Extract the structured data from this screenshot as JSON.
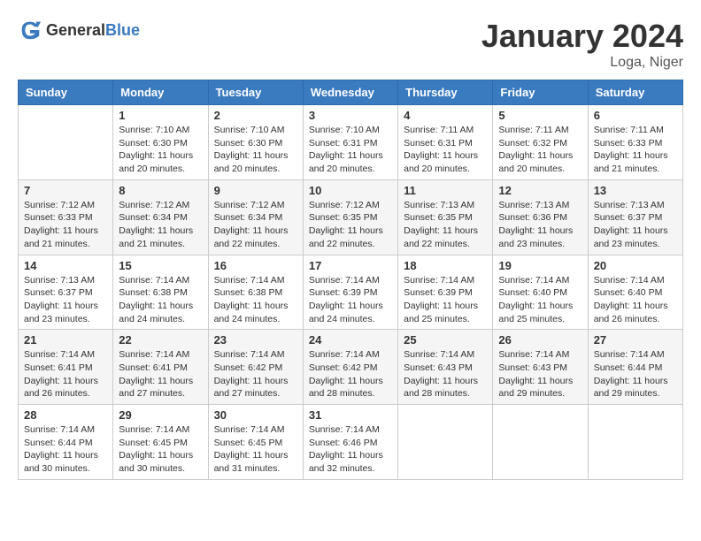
{
  "header": {
    "logo_general": "General",
    "logo_blue": "Blue",
    "month_title": "January 2024",
    "location": "Loga, Niger"
  },
  "weekdays": [
    "Sunday",
    "Monday",
    "Tuesday",
    "Wednesday",
    "Thursday",
    "Friday",
    "Saturday"
  ],
  "weeks": [
    [
      {
        "day": "",
        "sunrise": "",
        "sunset": "",
        "daylight": ""
      },
      {
        "day": "1",
        "sunrise": "Sunrise: 7:10 AM",
        "sunset": "Sunset: 6:30 PM",
        "daylight": "Daylight: 11 hours and 20 minutes."
      },
      {
        "day": "2",
        "sunrise": "Sunrise: 7:10 AM",
        "sunset": "Sunset: 6:30 PM",
        "daylight": "Daylight: 11 hours and 20 minutes."
      },
      {
        "day": "3",
        "sunrise": "Sunrise: 7:10 AM",
        "sunset": "Sunset: 6:31 PM",
        "daylight": "Daylight: 11 hours and 20 minutes."
      },
      {
        "day": "4",
        "sunrise": "Sunrise: 7:11 AM",
        "sunset": "Sunset: 6:31 PM",
        "daylight": "Daylight: 11 hours and 20 minutes."
      },
      {
        "day": "5",
        "sunrise": "Sunrise: 7:11 AM",
        "sunset": "Sunset: 6:32 PM",
        "daylight": "Daylight: 11 hours and 20 minutes."
      },
      {
        "day": "6",
        "sunrise": "Sunrise: 7:11 AM",
        "sunset": "Sunset: 6:33 PM",
        "daylight": "Daylight: 11 hours and 21 minutes."
      }
    ],
    [
      {
        "day": "7",
        "sunrise": "Sunrise: 7:12 AM",
        "sunset": "Sunset: 6:33 PM",
        "daylight": "Daylight: 11 hours and 21 minutes."
      },
      {
        "day": "8",
        "sunrise": "Sunrise: 7:12 AM",
        "sunset": "Sunset: 6:34 PM",
        "daylight": "Daylight: 11 hours and 21 minutes."
      },
      {
        "day": "9",
        "sunrise": "Sunrise: 7:12 AM",
        "sunset": "Sunset: 6:34 PM",
        "daylight": "Daylight: 11 hours and 22 minutes."
      },
      {
        "day": "10",
        "sunrise": "Sunrise: 7:12 AM",
        "sunset": "Sunset: 6:35 PM",
        "daylight": "Daylight: 11 hours and 22 minutes."
      },
      {
        "day": "11",
        "sunrise": "Sunrise: 7:13 AM",
        "sunset": "Sunset: 6:35 PM",
        "daylight": "Daylight: 11 hours and 22 minutes."
      },
      {
        "day": "12",
        "sunrise": "Sunrise: 7:13 AM",
        "sunset": "Sunset: 6:36 PM",
        "daylight": "Daylight: 11 hours and 23 minutes."
      },
      {
        "day": "13",
        "sunrise": "Sunrise: 7:13 AM",
        "sunset": "Sunset: 6:37 PM",
        "daylight": "Daylight: 11 hours and 23 minutes."
      }
    ],
    [
      {
        "day": "14",
        "sunrise": "Sunrise: 7:13 AM",
        "sunset": "Sunset: 6:37 PM",
        "daylight": "Daylight: 11 hours and 23 minutes."
      },
      {
        "day": "15",
        "sunrise": "Sunrise: 7:14 AM",
        "sunset": "Sunset: 6:38 PM",
        "daylight": "Daylight: 11 hours and 24 minutes."
      },
      {
        "day": "16",
        "sunrise": "Sunrise: 7:14 AM",
        "sunset": "Sunset: 6:38 PM",
        "daylight": "Daylight: 11 hours and 24 minutes."
      },
      {
        "day": "17",
        "sunrise": "Sunrise: 7:14 AM",
        "sunset": "Sunset: 6:39 PM",
        "daylight": "Daylight: 11 hours and 24 minutes."
      },
      {
        "day": "18",
        "sunrise": "Sunrise: 7:14 AM",
        "sunset": "Sunset: 6:39 PM",
        "daylight": "Daylight: 11 hours and 25 minutes."
      },
      {
        "day": "19",
        "sunrise": "Sunrise: 7:14 AM",
        "sunset": "Sunset: 6:40 PM",
        "daylight": "Daylight: 11 hours and 25 minutes."
      },
      {
        "day": "20",
        "sunrise": "Sunrise: 7:14 AM",
        "sunset": "Sunset: 6:40 PM",
        "daylight": "Daylight: 11 hours and 26 minutes."
      }
    ],
    [
      {
        "day": "21",
        "sunrise": "Sunrise: 7:14 AM",
        "sunset": "Sunset: 6:41 PM",
        "daylight": "Daylight: 11 hours and 26 minutes."
      },
      {
        "day": "22",
        "sunrise": "Sunrise: 7:14 AM",
        "sunset": "Sunset: 6:41 PM",
        "daylight": "Daylight: 11 hours and 27 minutes."
      },
      {
        "day": "23",
        "sunrise": "Sunrise: 7:14 AM",
        "sunset": "Sunset: 6:42 PM",
        "daylight": "Daylight: 11 hours and 27 minutes."
      },
      {
        "day": "24",
        "sunrise": "Sunrise: 7:14 AM",
        "sunset": "Sunset: 6:42 PM",
        "daylight": "Daylight: 11 hours and 28 minutes."
      },
      {
        "day": "25",
        "sunrise": "Sunrise: 7:14 AM",
        "sunset": "Sunset: 6:43 PM",
        "daylight": "Daylight: 11 hours and 28 minutes."
      },
      {
        "day": "26",
        "sunrise": "Sunrise: 7:14 AM",
        "sunset": "Sunset: 6:43 PM",
        "daylight": "Daylight: 11 hours and 29 minutes."
      },
      {
        "day": "27",
        "sunrise": "Sunrise: 7:14 AM",
        "sunset": "Sunset: 6:44 PM",
        "daylight": "Daylight: 11 hours and 29 minutes."
      }
    ],
    [
      {
        "day": "28",
        "sunrise": "Sunrise: 7:14 AM",
        "sunset": "Sunset: 6:44 PM",
        "daylight": "Daylight: 11 hours and 30 minutes."
      },
      {
        "day": "29",
        "sunrise": "Sunrise: 7:14 AM",
        "sunset": "Sunset: 6:45 PM",
        "daylight": "Daylight: 11 hours and 30 minutes."
      },
      {
        "day": "30",
        "sunrise": "Sunrise: 7:14 AM",
        "sunset": "Sunset: 6:45 PM",
        "daylight": "Daylight: 11 hours and 31 minutes."
      },
      {
        "day": "31",
        "sunrise": "Sunrise: 7:14 AM",
        "sunset": "Sunset: 6:46 PM",
        "daylight": "Daylight: 11 hours and 32 minutes."
      },
      {
        "day": "",
        "sunrise": "",
        "sunset": "",
        "daylight": ""
      },
      {
        "day": "",
        "sunrise": "",
        "sunset": "",
        "daylight": ""
      },
      {
        "day": "",
        "sunrise": "",
        "sunset": "",
        "daylight": ""
      }
    ]
  ]
}
